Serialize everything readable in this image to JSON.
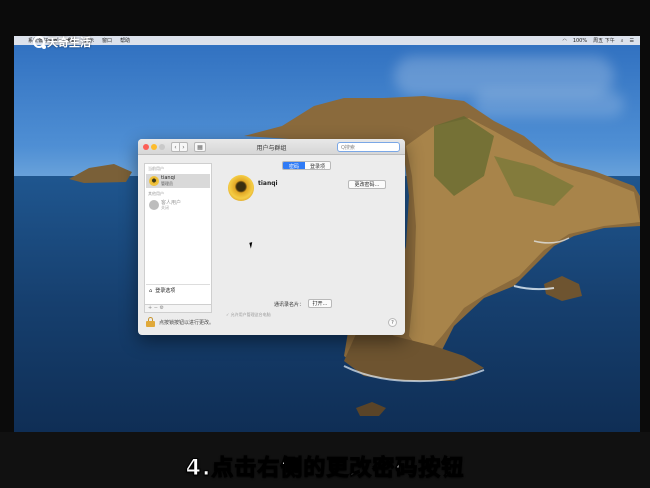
{
  "watermark": {
    "text": "天奇生活"
  },
  "menubar": {
    "apple": "",
    "items": [
      "系统偏好设置",
      "编辑",
      "显示",
      "窗口",
      "帮助"
    ],
    "right": {
      "battery": "100%",
      "clock": "周五 下午"
    }
  },
  "window": {
    "title": "用户与群组",
    "search_placeholder": "Q搜索",
    "nav_back": "‹",
    "nav_forward": "›",
    "grid_icon": "▦",
    "sidebar": {
      "current_user_header": "当前用户",
      "current_user": {
        "name": "tianqi",
        "role": "管理员"
      },
      "other_users_header": "其他用户",
      "guest": {
        "name": "客人用户",
        "sub": "关闭"
      },
      "login_options": "登录选项",
      "tools": "+ −  ⚙"
    },
    "main": {
      "tab_password": "密码",
      "tab_login_items": "登录项",
      "user_name": "tianqi",
      "change_password_button": "更改密码…",
      "contact_card_label": "通讯录名片：",
      "open_button": "打开…",
      "admin_checkbox": "✓ 允许用户管理这台电脑"
    },
    "bottom": {
      "lock_text": "点按锁按钮以进行更改。",
      "help": "?"
    }
  },
  "caption": "4.点击右侧的更改密码按钮"
}
